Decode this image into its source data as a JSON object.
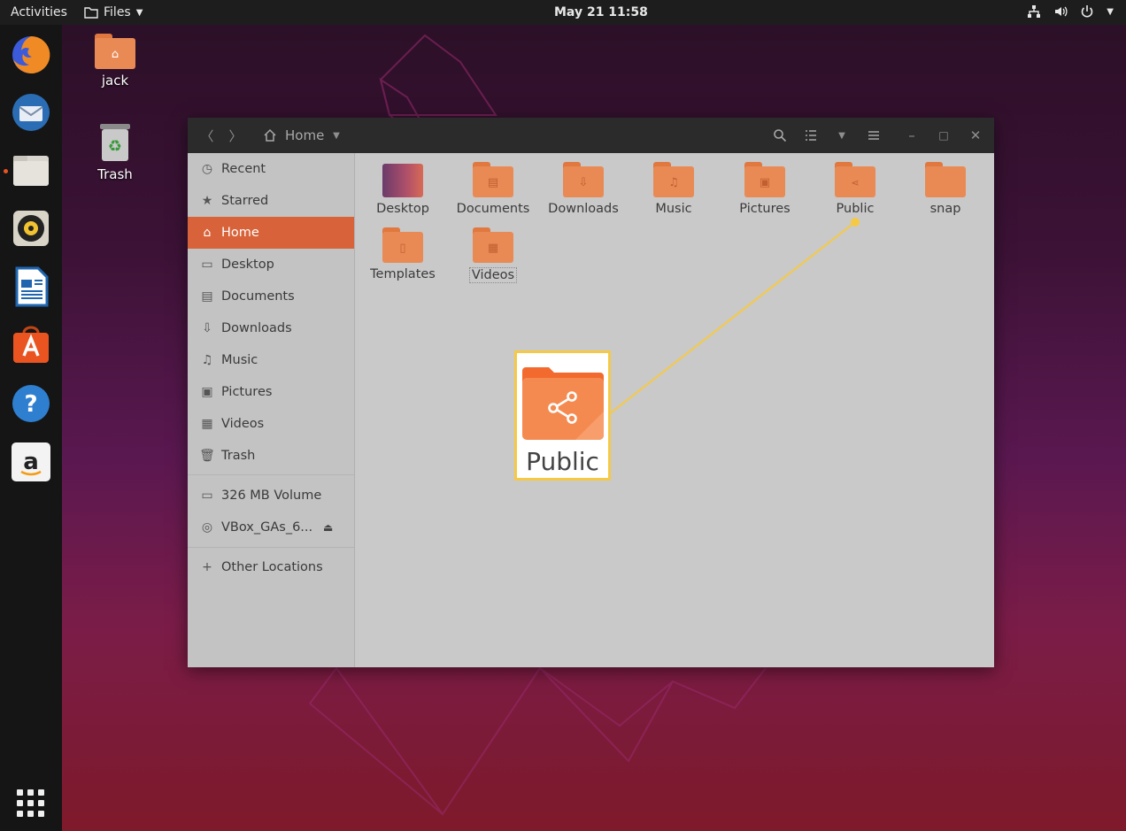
{
  "topbar": {
    "activities": "Activities",
    "app_menu": "Files",
    "clock": "May 21  11:58"
  },
  "desktop": {
    "icons": [
      {
        "label": "jack"
      },
      {
        "label": "Trash"
      }
    ]
  },
  "window": {
    "location": "Home",
    "sidebar": {
      "items": [
        {
          "label": "Recent",
          "icon": "clock-icon"
        },
        {
          "label": "Starred",
          "icon": "star-icon"
        },
        {
          "label": "Home",
          "icon": "home-icon",
          "active": true
        },
        {
          "label": "Desktop",
          "icon": "desktop-icon"
        },
        {
          "label": "Documents",
          "icon": "document-icon"
        },
        {
          "label": "Downloads",
          "icon": "download-icon"
        },
        {
          "label": "Music",
          "icon": "music-icon"
        },
        {
          "label": "Pictures",
          "icon": "picture-icon"
        },
        {
          "label": "Videos",
          "icon": "video-icon"
        },
        {
          "label": "Trash",
          "icon": "trash-icon"
        }
      ],
      "devices": [
        {
          "label": "326 MB Volume",
          "icon": "drive-icon"
        },
        {
          "label": "VBox_GAs_6...",
          "icon": "disc-icon"
        }
      ],
      "other": "Other Locations"
    },
    "files": [
      {
        "label": "Desktop"
      },
      {
        "label": "Documents"
      },
      {
        "label": "Downloads"
      },
      {
        "label": "Music"
      },
      {
        "label": "Pictures"
      },
      {
        "label": "Public"
      },
      {
        "label": "snap"
      },
      {
        "label": "Templates"
      },
      {
        "label": "Videos"
      }
    ]
  },
  "callout": {
    "label": "Public",
    "accent": "#f6c945"
  },
  "colors": {
    "ubuntu_orange": "#e95420",
    "sidebar_active": "#d8633a",
    "folder": "#e98a55"
  }
}
